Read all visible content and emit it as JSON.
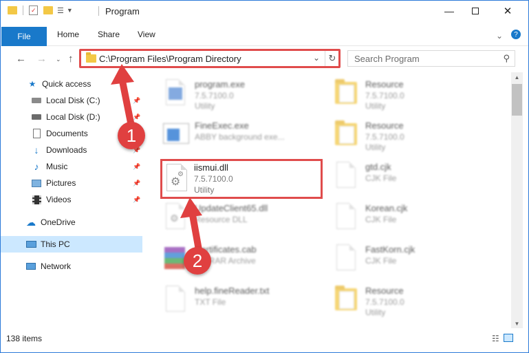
{
  "window": {
    "title": "Program"
  },
  "ribbon": {
    "tabs": [
      "File",
      "Home",
      "Share",
      "View"
    ]
  },
  "address": {
    "path": "C:\\Program Files\\Program Directory"
  },
  "search": {
    "placeholder": "Search Program"
  },
  "nav": {
    "items": [
      {
        "label": "Quick access",
        "icon": "star-icon"
      },
      {
        "label": "Local Disk (C:)",
        "icon": "drive-icon",
        "pinned": true
      },
      {
        "label": "Local Disk (D:)",
        "icon": "drive-icon",
        "pinned": true
      },
      {
        "label": "Documents",
        "icon": "documents-icon",
        "pinned": true
      },
      {
        "label": "Downloads",
        "icon": "download-icon",
        "pinned": true
      },
      {
        "label": "Music",
        "icon": "music-icon",
        "pinned": true
      },
      {
        "label": "Pictures",
        "icon": "pictures-icon",
        "pinned": true
      },
      {
        "label": "Videos",
        "icon": "videos-icon",
        "pinned": true
      },
      {
        "label": "OneDrive",
        "icon": "cloud-icon"
      },
      {
        "label": "This PC",
        "icon": "computer-icon",
        "selected": true
      },
      {
        "label": "Network",
        "icon": "network-icon"
      }
    ]
  },
  "files": {
    "left": [
      {
        "name": "program.exe",
        "line2": "7.5.7100.0",
        "line3": "Utility"
      },
      {
        "name": "FineExec.exe",
        "line2": "ABBY background exe...",
        "line3": ""
      },
      {
        "name": "iismui.dll",
        "line2": "7.5.7100.0",
        "line3": "Utility"
      },
      {
        "name": "UpdateClient65.dll",
        "line2": "Resource DLL",
        "line3": ""
      },
      {
        "name": "Certificates.cab",
        "line2": "WinRAR Archive",
        "line3": ""
      },
      {
        "name": "help.fineReader.txt",
        "line2": "TXT File",
        "line3": ""
      }
    ],
    "right": [
      {
        "name": "Resource",
        "line2": "7.5.7100.0",
        "line3": "Utility"
      },
      {
        "name": "Resource",
        "line2": "7.5.7100.0",
        "line3": "Utility"
      },
      {
        "name": "gtd.cjk",
        "line2": "CJK File",
        "line3": ""
      },
      {
        "name": "Korean.cjk",
        "line2": "CJK File",
        "line3": ""
      },
      {
        "name": "FastKorn.cjk",
        "line2": "CJK File",
        "line3": ""
      },
      {
        "name": "Resource",
        "line2": "7.5.7100.0",
        "line3": "Utility"
      }
    ]
  },
  "status": {
    "count": "138 items"
  },
  "callouts": [
    "1",
    "2"
  ],
  "colors": {
    "accent": "#1979ca",
    "highlight": "#e04c4c",
    "folder": "#f3c846",
    "selected": "#cce8ff"
  }
}
